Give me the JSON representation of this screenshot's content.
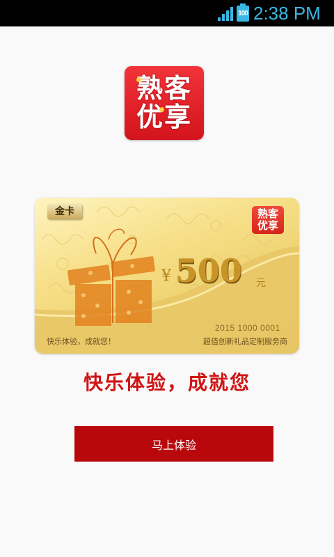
{
  "status_bar": {
    "battery_level": "100",
    "time": "2:38 PM",
    "icons": [
      "signal-icon",
      "battery-icon"
    ]
  },
  "app_logo": {
    "line1": "熟客",
    "line2": "优享"
  },
  "gift_card": {
    "level_badge": "金卡",
    "logo_line1": "熟客",
    "logo_line2": "优享",
    "currency_symbol": "¥",
    "amount": "500",
    "amount_unit": "元",
    "card_number": "2015 1000 0001",
    "tagline": "快乐体验，成就您！",
    "service_text": "超值创新礼品定制服务商"
  },
  "slogan": "快乐体验，成就您",
  "cta_button_label": "马上体验",
  "colors": {
    "accent_red": "#b9080c",
    "slogan_red": "#d01414",
    "status_blue": "#3ab7e3",
    "card_gold": "#eccf6a"
  }
}
